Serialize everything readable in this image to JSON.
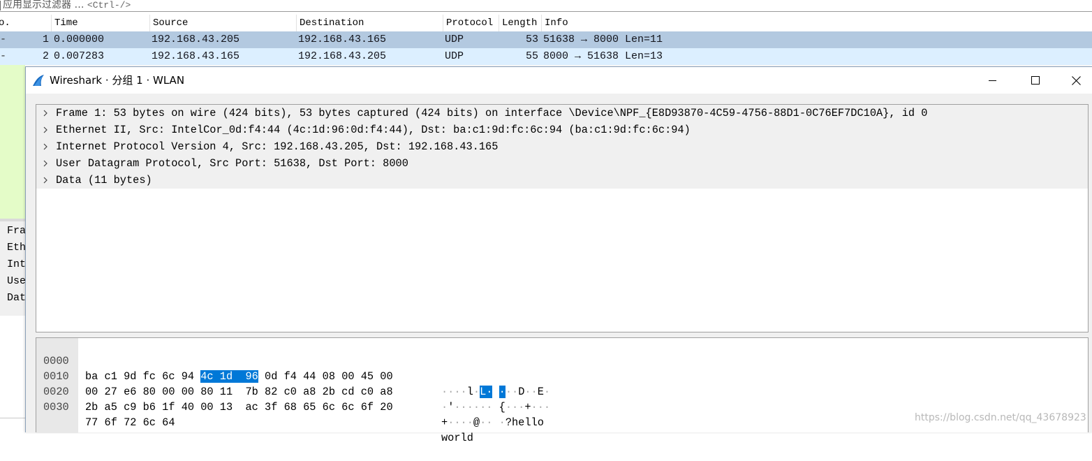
{
  "filter_bar": {
    "placeholder_text": "应用显示过滤器 …",
    "shortcut": "<Ctrl-/>"
  },
  "packet_list": {
    "columns": [
      "o.",
      "Time",
      "Source",
      "Destination",
      "Protocol",
      "Length",
      "Info"
    ],
    "rows": [
      {
        "marker": "-",
        "no": "1",
        "time": "0.000000",
        "source": "192.168.43.205",
        "destination": "192.168.43.165",
        "protocol": "UDP",
        "length": "53",
        "info": "51638 → 8000 Len=11"
      },
      {
        "marker": "-",
        "no": "2",
        "time": "0.007283",
        "source": "192.168.43.165",
        "destination": "192.168.43.205",
        "protocol": "UDP",
        "length": "55",
        "info": "8000 → 51638 Len=13"
      }
    ]
  },
  "background_details": {
    "items": [
      "Fra",
      "Eth",
      "Int",
      "Use",
      "Dat"
    ]
  },
  "packet_window": {
    "title": "Wireshark · 分组 1 · WLAN",
    "icon": "shark-fin-icon",
    "controls": {
      "minimize": "minimize-icon",
      "maximize": "maximize-icon",
      "close": "close-icon"
    },
    "tree": [
      "Frame 1: 53 bytes on wire (424 bits), 53 bytes captured (424 bits) on interface \\Device\\NPF_{E8D93870-4C59-4756-88D1-0C76EF7DC10A}, id 0",
      "Ethernet II, Src: IntelCor_0d:f4:44 (4c:1d:96:0d:f4:44), Dst: ba:c1:9d:fc:6c:94 (ba:c1:9d:fc:6c:94)",
      "Internet Protocol Version 4, Src: 192.168.43.205, Dst: 192.168.43.165",
      "User Datagram Protocol, Src Port: 51638, Dst Port: 8000",
      "Data (11 bytes)"
    ],
    "bytes": [
      {
        "offset": "0000",
        "hex_a": "ba c1 9d fc 6c 94",
        "hex_hl": "4c 1d  96",
        "hex_b": " 0d f4 44 08 00 45 00",
        "ascii": "····l·L· ··D··E·"
      },
      {
        "offset": "0010",
        "hex_a": "00 27 e6 80 00 00 80 11  7b 82 c0 a8 2b cd c0 a8",
        "hex_hl": "",
        "hex_b": "",
        "ascii": "·'······ {···+···"
      },
      {
        "offset": "0020",
        "hex_a": "2b a5 c9 b6 1f 40 00 13  ac 3f 68 65 6c 6c 6f 20",
        "hex_hl": "",
        "hex_b": "",
        "ascii": "+····@·· ·?hello "
      },
      {
        "offset": "0030",
        "hex_a": "77 6f 72 6c 64",
        "hex_hl": "",
        "hex_b": "",
        "ascii": "world"
      }
    ]
  },
  "watermark": "https://blog.csdn.net/qq_43678923",
  "colors": {
    "row_selected": "#b3c9e0",
    "row_alt": "#dcefff",
    "udp_bg": "#e4fcc8",
    "byte_highlight": "#0078d7"
  }
}
